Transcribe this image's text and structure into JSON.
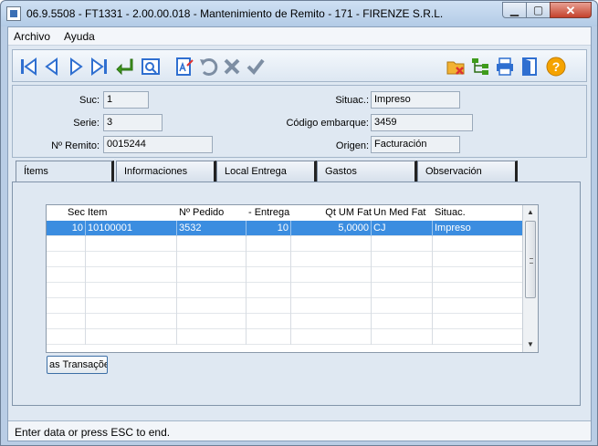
{
  "window": {
    "title": "06.9.5508 - FT1331 - 2.00.00.018 - Mantenimiento de Remito - 171 - FIRENZE S.R.L."
  },
  "menu": {
    "archivo": "Archivo",
    "ayuda": "Ayuda"
  },
  "toolbar": {
    "icons": [
      "first-record",
      "previous-record",
      "next-record",
      "last-record",
      "enter",
      "preview",
      "edit",
      "undo",
      "cancel",
      "confirm",
      "folder-cancel",
      "tree",
      "print",
      "exit",
      "help"
    ],
    "colors": {
      "nav_blue": "#2f6fd0",
      "green": "#3e9b1c",
      "gray": "#7d8ea3",
      "help": "#f5a300"
    }
  },
  "header": {
    "suc_label": "Suc:",
    "suc_value": "1",
    "serie_label": "Serie:",
    "serie_value": "3",
    "remito_label": "Nº Remito:",
    "remito_value": "0015244",
    "situac_label": "Situac.:",
    "situac_value": "Impreso",
    "embarque_label": "Código embarque:",
    "embarque_value": "3459",
    "origen_label": "Origen:",
    "origen_value": "Facturación"
  },
  "tabs": [
    {
      "label": "Ítems"
    },
    {
      "label": "Informaciones"
    },
    {
      "label": "Local Entrega"
    },
    {
      "label": "Gastos"
    },
    {
      "label": "Observación"
    }
  ],
  "grid": {
    "columns": [
      "Sec",
      "Item",
      "Nº Pedido",
      "- Entrega",
      "Qt UM Fat",
      "Un Med Fat",
      "Situac."
    ],
    "rows": [
      {
        "sec": "10",
        "item": "10100001",
        "pedido": "3532",
        "entrega": "10",
        "qt": "5,0000",
        "um": "CJ",
        "situac": "Impreso"
      }
    ],
    "selected_color": "#3b8de0"
  },
  "buttons": {
    "transacoes": "as Transaçõe"
  },
  "status": {
    "text": "Enter data or press ESC to end."
  }
}
